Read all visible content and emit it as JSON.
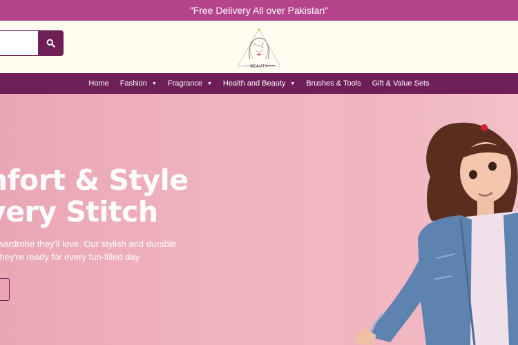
{
  "announcement": "\"Free Delivery All over Pakistan\"",
  "logo": {
    "text": "BEAUTY"
  },
  "nav": [
    {
      "label": "Home",
      "has_dropdown": false
    },
    {
      "label": "Fashion",
      "has_dropdown": true
    },
    {
      "label": "Fragrance",
      "has_dropdown": true
    },
    {
      "label": "Health and Beauty",
      "has_dropdown": true
    },
    {
      "label": "Brushes & Tools",
      "has_dropdown": false
    },
    {
      "label": "Gift & Value Sets",
      "has_dropdown": false
    }
  ],
  "hero": {
    "heading_line1": "nfort & Style",
    "heading_line2": "very Stitch",
    "text_line1": "wardrobe they'll love. Our stylish and durable",
    "text_line2": "they're ready for every fun-filled day"
  },
  "icons": {
    "search": "search-icon",
    "caret": "caret-down-icon"
  },
  "colors": {
    "announcement_bg": "#b5448c",
    "nav_bg": "#6e1f57",
    "header_bg": "#fffdf0",
    "hero_bg": "#f0b4bf"
  }
}
